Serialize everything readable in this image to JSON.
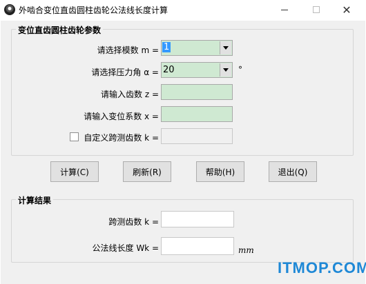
{
  "window": {
    "title": "外啮合变位直齿圆柱齿轮公法线长度计算",
    "min_symbol": "—",
    "max_symbol": "☐",
    "close_symbol": "✕"
  },
  "params": {
    "title": "变位直齿圆柱齿轮参数",
    "modulus_label": "请选择模数 m =",
    "modulus_value": "1",
    "pressure_angle_label": "请选择压力角 α =",
    "pressure_angle_value": "20",
    "degree_symbol": "°",
    "teeth_label": "请输入齿数 z =",
    "teeth_value": "",
    "shift_label": "请输入变位系数 x =",
    "shift_value": "",
    "custom_k_label": "自定义跨测齿数 k =",
    "custom_k_checked": false,
    "custom_k_value": ""
  },
  "buttons": {
    "calc": "计算(C)",
    "refresh": "刷新(R)",
    "help": "帮助(H)",
    "exit": "退出(Q)"
  },
  "results": {
    "title": "计算结果",
    "k_label": "跨测齿数 k =",
    "k_value": "",
    "wk_label": "公法线长度 Wk =",
    "wk_value": "",
    "unit": "mm"
  },
  "watermark": "ITMOP.COM"
}
